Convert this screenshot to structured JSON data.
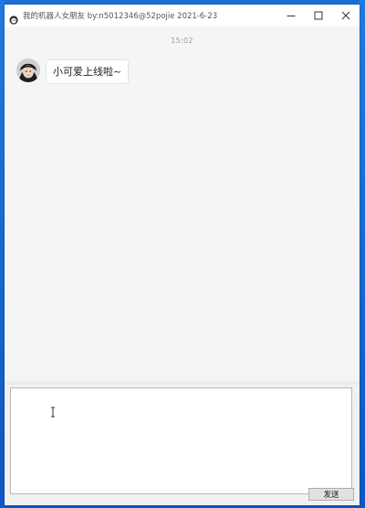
{
  "window": {
    "title": "我的机器人女朋友 by:n5012346@52pojie 2021-6-23"
  },
  "controls": {
    "minimize": "—",
    "maximize": "☐",
    "close": "✕"
  },
  "chat": {
    "timestamp": "15:02",
    "messages": [
      {
        "sender": "bot",
        "text": "小可爱上线啦~"
      }
    ]
  },
  "composer": {
    "value": "",
    "send_label": "发送"
  },
  "colors": {
    "desktop": "#1a6fd6",
    "chat_bg": "#f5f5f5",
    "bubble_bg": "#ffffff"
  }
}
